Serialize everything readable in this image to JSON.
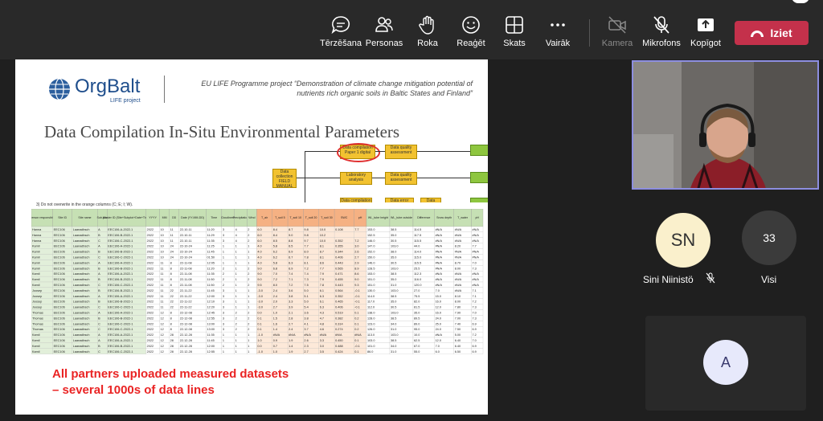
{
  "toolbar": {
    "buttons": [
      {
        "label": "Tērzēšana",
        "icon": "chat-icon"
      },
      {
        "label": "Personas",
        "icon": "people-icon"
      },
      {
        "label": "Roka",
        "icon": "raise-hand-icon"
      },
      {
        "label": "Reaģēt",
        "icon": "reaction-icon"
      },
      {
        "label": "Skats",
        "icon": "view-icon"
      },
      {
        "label": "Vairāk",
        "icon": "more-icon"
      },
      {
        "label": "Kamera",
        "icon": "camera-off-icon",
        "disabled": true
      },
      {
        "label": "Mikrofons",
        "icon": "mic-off-icon"
      },
      {
        "label": "Kopīgot",
        "icon": "share-icon"
      }
    ],
    "leave_label": "Iziet",
    "leave_color": "#c4314b"
  },
  "slide": {
    "logo_text": "OrgBalt",
    "logo_sub": "LIFE project",
    "project_text": "EU LIFE Programme project “Demonstration of climate change mitigation potential of nutrients rich organic soils in Baltic States and Finland”",
    "title": "Data Compilation In-Situ Environmental Parameters",
    "sheet_note": "3) Do not overwrite in the orange columns (C; E; I; W).",
    "caption_line1": "All partners uploaded measured datasets",
    "caption_line2": "– several 1000s of data lines",
    "flow": {
      "row1_left": "Data compilation Paper 1 digital",
      "row1_right": "Data quality assessment",
      "row2_left": "Laboratory analysis",
      "row2_right": "Data quality assessment",
      "row3_left": "Data compilation Paper 3 digital",
      "row3_right": "Data error upload",
      "row3_far": "Data quality assessment",
      "source": "Data collection FIELD",
      "manual": "MANUAL",
      "end": "Data availability"
    },
    "sheet": {
      "headers": [
        "Person responsible",
        "Site ID",
        "Site name",
        "Sub-plot",
        "Master ID (Site+Subplot+Date+Time)",
        "YYYY",
        "MM",
        "DD",
        "Date (YY-MM-DD)",
        "Time",
        "Cloudiness",
        "Precipitation",
        "Wind",
        "T_air",
        "T_soil 5",
        "T_soil 10",
        "T_soil 20",
        "T_soil 30",
        "SWC",
        "pH",
        "WL_tube height",
        "WL_tube outside",
        "Difference",
        "Snow depth",
        "T_water",
        "pH"
      ],
      "rows": [
        [
          "Hanna",
          "EEC106",
          "Laanadbsch",
          "A",
          "EEC106-A-2022-1",
          "2022",
          "10",
          "11",
          "22-10-11",
          "11:20",
          "3",
          "4",
          "2",
          "6.0",
          "8.4",
          "8.7",
          "9.8",
          "10.0",
          "0.108",
          "7.7",
          "153.0",
          "38.5",
          "114.5",
          "#N/A",
          "#N/A",
          "#N/A"
        ],
        [
          "Hanna",
          "EEC106",
          "Laanadbsch",
          "B",
          "EEC106-B-2022-1",
          "2022",
          "10",
          "11",
          "22-10-11",
          "11:29",
          "3",
          "4",
          "2",
          "6.0",
          "8.4",
          "9.0",
          "9.8",
          "10.2",
          "",
          "",
          "152.5",
          "35.0",
          "117.5",
          "#N/A",
          "#N/A",
          "#N/A"
        ],
        [
          "Hanna",
          "EEC106",
          "Laanadbsch",
          "C",
          "EEC106-C-2022-1",
          "2022",
          "10",
          "11",
          "22-10-11",
          "11:35",
          "3",
          "4",
          "2",
          "6.0",
          "8.5",
          "8.8",
          "9.7",
          "10.0",
          "0.352",
          "7.2",
          "146.0",
          "30.5",
          "115.5",
          "#N/A",
          "#N/A",
          "#N/A"
        ],
        [
          "Kamil",
          "EEC106",
          "Laanadbsch",
          "A",
          "EEC106-A-2022-1",
          "2022",
          "10",
          "24",
          "22-10-24",
          "11:25",
          "1",
          "1",
          "1",
          "4.0",
          "5.8",
          "6.5",
          "7.7",
          "8.1",
          "0.355",
          "3.0",
          "147.0",
          "103.0",
          "44.0",
          "#N/A",
          "8.20",
          "7.7"
        ],
        [
          "Kamil",
          "EEC106",
          "Laanadbsch",
          "B",
          "EEC106-B-2022-1",
          "2022",
          "10",
          "24",
          "22-10-24",
          "11:45",
          "1",
          "1",
          "1",
          "4.0",
          "6.2",
          "6.9",
          "8.0",
          "8.7",
          "0.344",
          "2.6",
          "152.0",
          "38.0",
          "114.0",
          "#N/A",
          "#N/A",
          "#N/A"
        ],
        [
          "Kamil",
          "EEC106",
          "Laanadbsch",
          "C",
          "EEC106-C-2022-1",
          "2022",
          "10",
          "24",
          "22-10-24",
          "01:50",
          "1",
          "1",
          "1",
          "4.0",
          "6.2",
          "6.7",
          "7.8",
          "8.1",
          "0.406",
          "2.7",
          "150.0",
          "35.0",
          "115.0",
          "#N/A",
          "#N/A",
          "#N/A"
        ],
        [
          "Kamil",
          "EEC106",
          "Laanadbsch",
          "A",
          "EEC106-A-2022-1",
          "2022",
          "11",
          "8",
          "22-11-08",
          "12:05",
          "1",
          "1",
          "1",
          "4.0",
          "5.8",
          "6.3",
          "8.1",
          "8.6",
          "0.443",
          "2.9",
          "146.0",
          "30.5",
          "115.5",
          "#N/A",
          "8.70",
          "7.0"
        ],
        [
          "Kamil",
          "EEC106",
          "Laanadbsch",
          "B",
          "EEC106-B-2022-1",
          "2022",
          "11",
          "8",
          "22-11-08",
          "11:20",
          "2",
          "1",
          "2",
          "9.0",
          "6.8",
          "6.9",
          "7.2",
          "7.7",
          "0.565",
          "8.9",
          "128.5",
          "103.0",
          "25.5",
          "#N/A",
          "8.00",
          "7.3"
        ],
        [
          "Kamil",
          "EEC106",
          "Laanadbsch",
          "A",
          "EEC106-A-2022-1",
          "2022",
          "11",
          "8",
          "22-11-08",
          "11:35",
          "2",
          "1",
          "2",
          "9.0",
          "7.0",
          "7.4",
          "7.4",
          "7.9",
          "0.471",
          "8.6",
          "153.0",
          "38.5",
          "112.3",
          "#N/A",
          "#N/A",
          "#N/A"
        ],
        [
          "Kamil",
          "EEC106",
          "Laanadbsch",
          "B",
          "EEC106-B-2022-1",
          "2022",
          "11",
          "8",
          "22-11-08",
          "11:50",
          "2",
          "1",
          "2",
          "9.0",
          "7.2",
          "7.1",
          "7.3",
          "7.9",
          "0.455",
          "9.0",
          "151.0",
          "35.0",
          "116.0",
          "#N/A",
          "#N/A",
          "#N/A"
        ],
        [
          "Kamil",
          "EEC106",
          "Laanadbsch",
          "C",
          "EEC106-C-2022-1",
          "2022",
          "11",
          "8",
          "22-11-08",
          "11:50",
          "2",
          "1",
          "2",
          "9.5",
          "8.0",
          "7.2",
          "7.5",
          "7.8",
          "0.443",
          "9.3",
          "151.0",
          "31.0",
          "120.0",
          "#N/A",
          "#N/A",
          "#N/A"
        ],
        [
          "Joosep",
          "EEC106",
          "Laanadbsch",
          "B",
          "EEC106-B-2022-1",
          "2022",
          "11",
          "22",
          "22-11-22",
          "11:45",
          "3",
          "1",
          "1",
          "-3.0",
          "2.4",
          "3.6",
          "5.0",
          "6.1",
          "0.564",
          "-0.1",
          "130.0",
          "103.0",
          "27.0",
          "7.0",
          "#N/A",
          "7.1"
        ],
        [
          "Joosep",
          "EEC106",
          "Laanadbsch",
          "A",
          "EEC106-A-2022-1",
          "2022",
          "11",
          "22",
          "22-11-22",
          "12:00",
          "3",
          "1",
          "1",
          "-3.0",
          "2.4",
          "3.8",
          "5.1",
          "6.3",
          "0.352",
          "-0.1",
          "114.0",
          "38.5",
          "75.5",
          "15.0",
          "8.10",
          "7.1"
        ],
        [
          "Joosep",
          "EEC106",
          "Laanadbsch",
          "B",
          "EEC106-B-2022-1",
          "2022",
          "11",
          "22",
          "22-11-22",
          "12:10",
          "3",
          "1",
          "1",
          "-3.0",
          "2.0",
          "3.3",
          "5.0",
          "6.1",
          "0.465",
          "-0.1",
          "117.0",
          "35.0",
          "82.0",
          "16.0",
          "8.00",
          "7.2"
        ],
        [
          "Joosep",
          "EEC106",
          "Laanadbsch",
          "C",
          "EEC106-C-2022-1",
          "2022",
          "11",
          "22",
          "22-11-22",
          "12:20",
          "3",
          "1",
          "1",
          "-3.0",
          "2.7",
          "3.9",
          "5.4",
          "6.3",
          "0.406",
          "-0.1",
          "112.0",
          "30.5",
          "81.5",
          "12.0",
          "7.80",
          "7.3"
        ],
        [
          "Thomas",
          "EEC106",
          "Laanadbsch",
          "A",
          "EEC106-A-2022-1",
          "2022",
          "12",
          "8",
          "22-12-08",
          "12:45",
          "3",
          "2",
          "2",
          "0.0",
          "1.0",
          "2.1",
          "3.6",
          "4.3",
          "0.519",
          "0.1",
          "138.0",
          "103.0",
          "35.0",
          "16.0",
          "7.90",
          "7.0"
        ],
        [
          "Thomas",
          "EEC106",
          "Laanadbsch",
          "B",
          "EEC106-B-2022-1",
          "2022",
          "12",
          "8",
          "22-12-08",
          "12:55",
          "3",
          "2",
          "2",
          "0.1",
          "1.5",
          "2.8",
          "3.8",
          "4.7",
          "0.382",
          "0.2",
          "128.0",
          "38.5",
          "89.5",
          "24.0",
          "7.00",
          "7.3"
        ],
        [
          "Thomas",
          "EEC106",
          "Laanadbsch",
          "C",
          "EEC106-C-2022-1",
          "2022",
          "12",
          "8",
          "22-12-08",
          "13:00",
          "3",
          "2",
          "2",
          "0.1",
          "1.6",
          "2.7",
          "4.1",
          "4.8",
          "0.314",
          "0.1",
          "123.0",
          "34.0",
          "89.0",
          "25.0",
          "7.40",
          "6.9"
        ],
        [
          "Thomas",
          "EEC106",
          "Laanadbsch",
          "C",
          "EEC106-C-2022-1",
          "2022",
          "12",
          "8",
          "22-12-08",
          "13:00",
          "3",
          "2",
          "2",
          "0.1",
          "1.4",
          "2.4",
          "3.7",
          "4.6",
          "0.274",
          "0.2",
          "126.0",
          "31.0",
          "95.0",
          "24.0",
          "7.50",
          "6.9"
        ],
        [
          "Kamil",
          "EEC106",
          "Laanadbsch",
          "A",
          "EEC106-A-2022-1",
          "2022",
          "12",
          "28",
          "22-12-28",
          "11:35",
          "1",
          "1",
          "1",
          "-1.0",
          "#N/A",
          "#N/A",
          "#N/A",
          "#N/A",
          "#N/A",
          "#N/A",
          "113.0",
          "103.0",
          "10.0",
          "#N/A",
          "5.00",
          "7.2"
        ],
        [
          "Kamil",
          "EEC106",
          "Laanadbsch",
          "A",
          "EEC106-A-2022-1",
          "2022",
          "12",
          "28",
          "22-12-28",
          "11:45",
          "1",
          "1",
          "1",
          "1.0",
          "0.9",
          "1.9",
          "2.6",
          "3.3",
          "0.450",
          "0.1",
          "103.0",
          "38.5",
          "62.5",
          "12.0",
          "6.40",
          "7.0"
        ],
        [
          "Kamil",
          "EEC106",
          "Laanadbsch",
          "B",
          "EEC106-B-2022-1",
          "2022",
          "12",
          "28",
          "22-12-28",
          "12:00",
          "1",
          "1",
          "1",
          "0.0",
          "0.7",
          "1.4",
          "2.3",
          "3.0",
          "0.488",
          "-0.1",
          "101.0",
          "34.0",
          "67.0",
          "7.0",
          "6.40",
          "6.9"
        ],
        [
          "Kamil",
          "EEC106",
          "Laanadbsch",
          "C",
          "EEC106-C-2022-1",
          "2022",
          "12",
          "28",
          "22-12-28",
          "12:55",
          "1",
          "1",
          "1",
          "-1.0",
          "1.0",
          "1.9",
          "2.7",
          "3.5",
          "0.424",
          "0.1",
          "86.0",
          "31.0",
          "55.0",
          "6.0",
          "6.50",
          "6.9"
        ]
      ]
    }
  },
  "participants": {
    "video_person": "Speaker video feed",
    "sn_initials": "SN",
    "sn_name": "Sini Niinistö",
    "visi_count": "33",
    "visi_label": "Visi",
    "a_initial": "A"
  }
}
